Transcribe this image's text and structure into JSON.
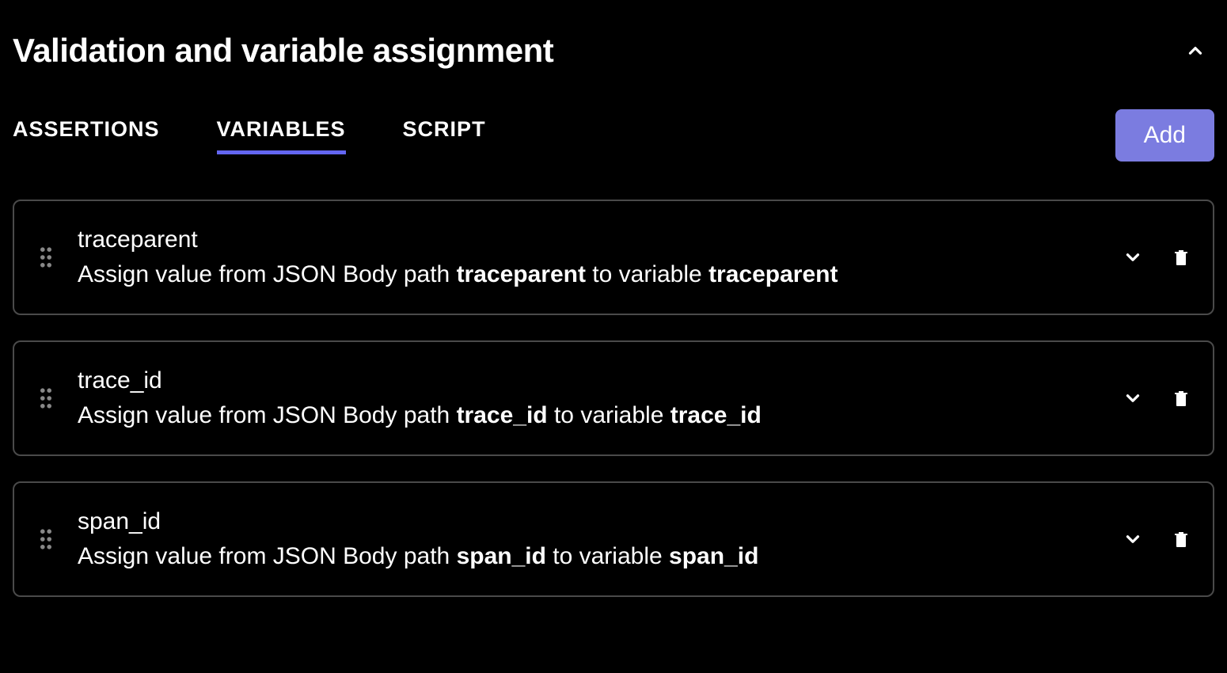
{
  "header": {
    "title": "Validation and variable assignment"
  },
  "tabs": [
    {
      "label": "ASSERTIONS",
      "active": false
    },
    {
      "label": "VARIABLES",
      "active": true
    },
    {
      "label": "SCRIPT",
      "active": false
    }
  ],
  "add_button": {
    "label": "Add"
  },
  "desc_template": {
    "prefix": "Assign value from JSON Body path ",
    "middle": " to variable "
  },
  "variables": [
    {
      "name": "traceparent",
      "json_path": "traceparent",
      "variable": "traceparent"
    },
    {
      "name": "trace_id",
      "json_path": "trace_id",
      "variable": "trace_id"
    },
    {
      "name": "span_id",
      "json_path": "span_id",
      "variable": "span_id"
    }
  ]
}
